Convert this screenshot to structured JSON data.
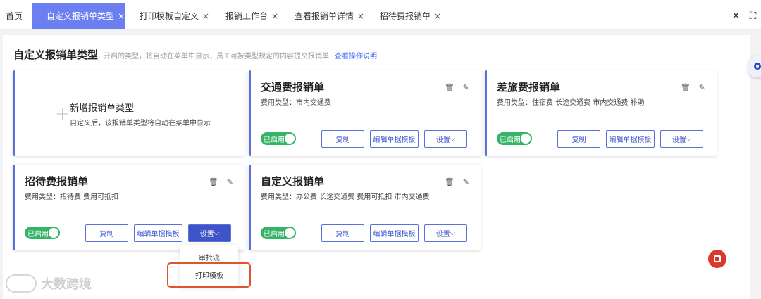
{
  "tabs": [
    {
      "label": "首页",
      "closable": false,
      "active": false
    },
    {
      "label": "自定义报销单类型",
      "closable": true,
      "active": true
    },
    {
      "label": "打印模板自定义",
      "closable": true,
      "active": false
    },
    {
      "label": "报销工作台",
      "closable": true,
      "active": false
    },
    {
      "label": "查看报销单详情",
      "closable": true,
      "active": false
    },
    {
      "label": "招待费报销单",
      "closable": true,
      "active": false
    }
  ],
  "tab_close_glyph": "×",
  "toolbar": {
    "close_all": "✕",
    "fullscreen": "⛶"
  },
  "header": {
    "title": "自定义报销单类型",
    "subtitle": "开启的类型，将自动在菜单中显示，员工可按类型规定的内容提交报销单",
    "help_link": "查看操作说明"
  },
  "add_card": {
    "plus": "+",
    "title": "新增报销单类型",
    "subtitle": "自定义后，该报销单类型将自动在菜单中显示"
  },
  "cards": [
    {
      "title": "交通费报销单",
      "types": "费用类型：市内交通费",
      "toggle": "已启用",
      "copy": "复制",
      "edit_template": "编辑单据模板",
      "settings": "设置"
    },
    {
      "title": "差旅费报销单",
      "types": "费用类型：住宿费 长途交通费 市内交通费 补助",
      "toggle": "已启用",
      "copy": "复制",
      "edit_template": "编辑单据模板",
      "settings": "设置"
    },
    {
      "title": "招待费报销单",
      "types": "费用类型：招待费 费用可抵扣",
      "toggle": "已启用",
      "copy": "复制",
      "edit_template": "编辑单据模板",
      "settings": "设置"
    },
    {
      "title": "自定义报销单",
      "types": "费用类型：办公费 长途交通费 费用可抵扣 市内交通费",
      "toggle": "已启用",
      "copy": "复制",
      "edit_template": "编辑单据模板",
      "settings": "设置"
    }
  ],
  "icons": {
    "delete": "🗑",
    "edit": "✎",
    "chevron": "⌵"
  },
  "settings_menu": {
    "items": [
      "审批流",
      "打印模板"
    ],
    "highlighted": "打印模板"
  },
  "watermark": "大数跨境",
  "colors": {
    "accent": "#5b6fd8",
    "active_tab": "#6b7ff0",
    "toggle_on": "#35b468",
    "highlight": "#e0532f"
  }
}
